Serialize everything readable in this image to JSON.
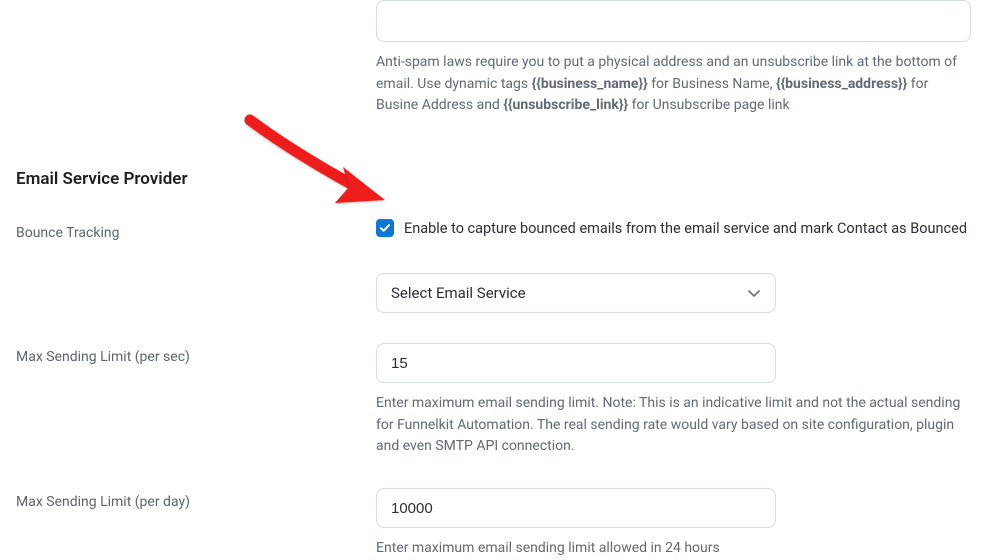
{
  "top_help_html": "Anti-spam laws require you to put a physical address and an unsubscribe link at the bottom of email. Use dynamic tags <b>{{business_name}}</b> for Business Name, <b>{{business_address}}</b> for Busine Address and <b>{{unsubscribe_link}}</b> for Unsubscribe page link",
  "section": {
    "title": "Email Service Provider"
  },
  "bounce": {
    "label": "Bounce Tracking",
    "checkbox_label": "Enable to capture bounced emails from the email service and mark Contact as Bounced",
    "checked": true,
    "select_placeholder": "Select Email Service"
  },
  "limit_sec": {
    "label": "Max Sending Limit (per sec)",
    "value": "15",
    "help": "Enter maximum email sending limit. Note: This is an indicative limit and not the actual sending for Funnelkit Automation. The real sending rate would vary based on site configuration, plugin and even SMTP API connection."
  },
  "limit_day": {
    "label": "Max Sending Limit (per day)",
    "value": "10000",
    "help": "Enter maximum email sending limit allowed in 24 hours"
  }
}
